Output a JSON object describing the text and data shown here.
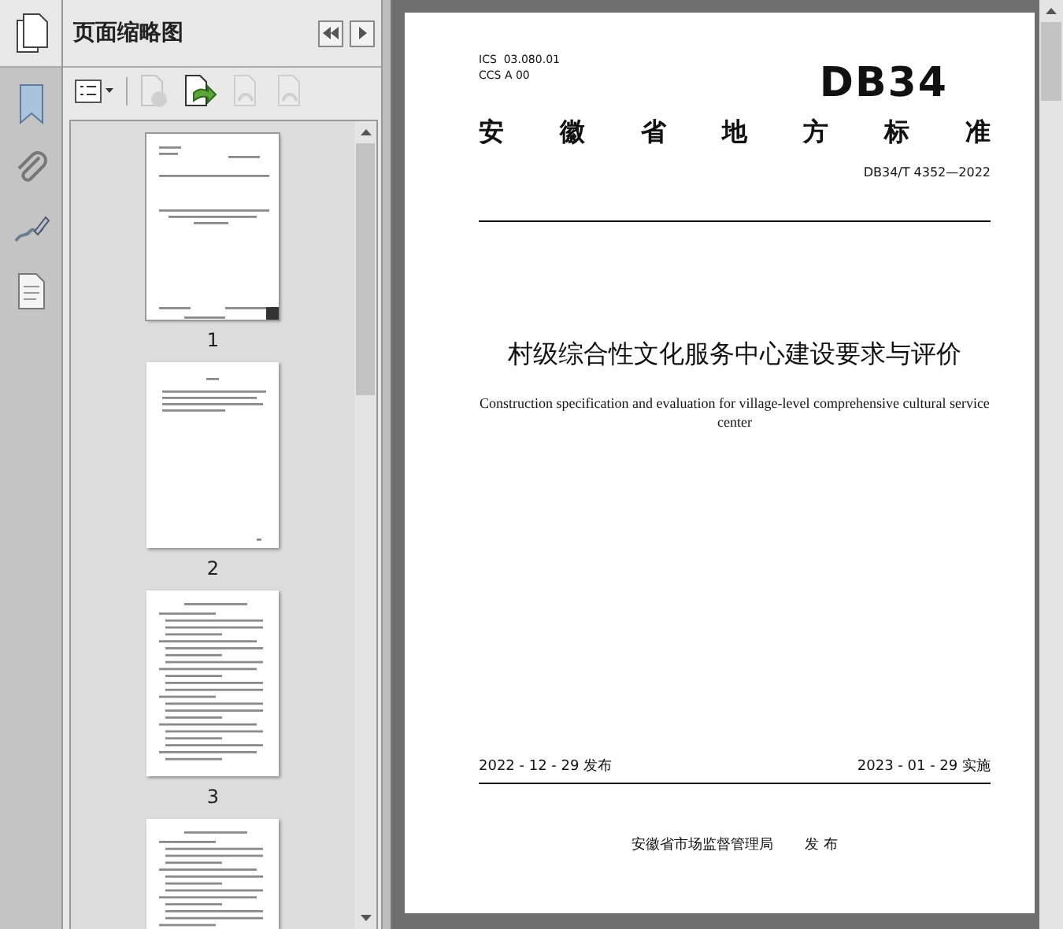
{
  "panel": {
    "title": "页面缩略图"
  },
  "toolbar": [
    {
      "kind": "options",
      "disabled": false
    },
    {
      "kind": "delete",
      "disabled": true
    },
    {
      "kind": "insert",
      "disabled": false
    },
    {
      "kind": "rotate-left",
      "disabled": true
    },
    {
      "kind": "rotate-right",
      "disabled": true
    }
  ],
  "thumbnails": [
    {
      "label": "1",
      "kind": "cover",
      "selected": true
    },
    {
      "label": "2",
      "kind": "foreword",
      "selected": false
    },
    {
      "label": "3",
      "kind": "body",
      "selected": false
    },
    {
      "kind": "body",
      "selected": false
    }
  ],
  "document": {
    "ics": "ICS  03.080.01",
    "ccs": "CCS A 00",
    "logo": "DB34",
    "authority": "安徽省地方标准",
    "number": "DB34/T 4352—2022",
    "title": "村级综合性文化服务中心建设要求与评价",
    "subtitle": "Construction specification and evaluation for village-level comprehensive cultural service center",
    "release_date": "2022 - 12 - 29 发布",
    "effective_date": "2023 - 01 - 29 实施",
    "publisher": "安徽省市场监督管理局",
    "publish_word": "发 布"
  }
}
